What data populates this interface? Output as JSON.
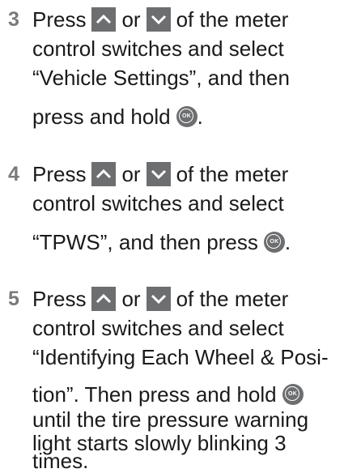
{
  "colors": {
    "step_number": "#7a7a7a",
    "key_fill": "#6d6e70",
    "text": "#1a1a1a"
  },
  "icons": {
    "up": "up-arrow-key-icon",
    "down": "down-arrow-key-icon",
    "ok": "ok-button-icon"
  },
  "ok_label": "OK",
  "steps": [
    {
      "number": "3",
      "lines": [
        {
          "a": "Press",
          "b": "or",
          "c": "of the meter"
        },
        "control switches and select",
        "“Vehicle Settings”, and then",
        {
          "a": "press and hold",
          "c": "."
        }
      ]
    },
    {
      "number": "4",
      "lines": [
        {
          "a": "Press",
          "b": "or",
          "c": "of the meter"
        },
        "control switches and select",
        {
          "a": "“TPWS”, and then press",
          "c": "."
        }
      ]
    },
    {
      "number": "5",
      "lines": [
        {
          "a": "Press",
          "b": "or",
          "c": "of the meter"
        },
        "control switches and select",
        "“Identifying Each Wheel & Posi-",
        {
          "a": "tion”. Then press and hold"
        },
        "until the tire pressure warning",
        "light starts slowly blinking 3",
        "times."
      ]
    }
  ]
}
